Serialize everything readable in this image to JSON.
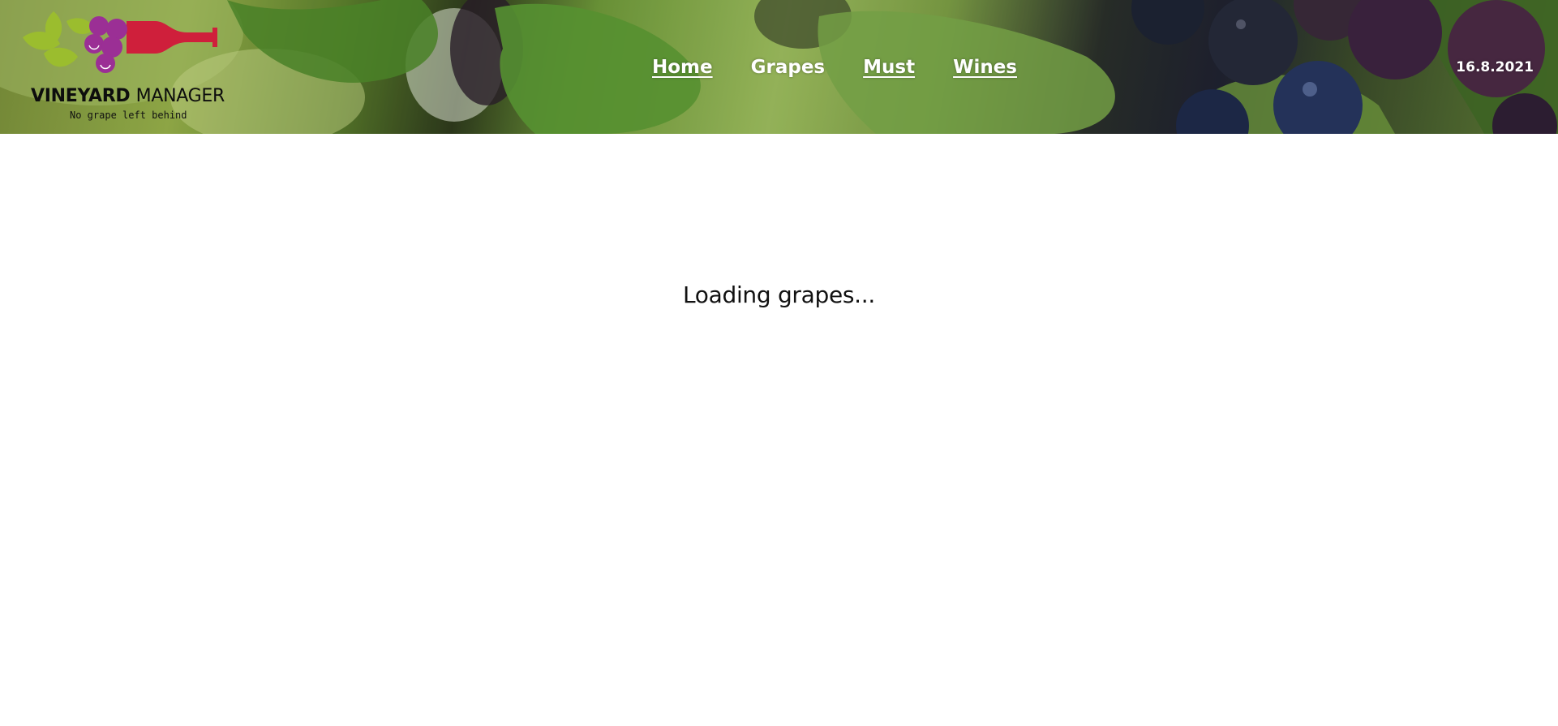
{
  "brand": {
    "title_bold": "VINEYARD",
    "title_light": "MANAGER",
    "tagline": "No grape left behind"
  },
  "nav": {
    "items": [
      {
        "label": "Home"
      },
      {
        "label": "Grapes"
      },
      {
        "label": "Must"
      },
      {
        "label": "Wines"
      }
    ]
  },
  "header": {
    "date": "16.8.2021"
  },
  "main": {
    "status": "Loading grapes..."
  },
  "colors": {
    "leaf_green": "#9bbd2e",
    "grape_purple": "#9b2f95",
    "bottle_red": "#cf1f3b",
    "nav_text": "#ffffff"
  }
}
